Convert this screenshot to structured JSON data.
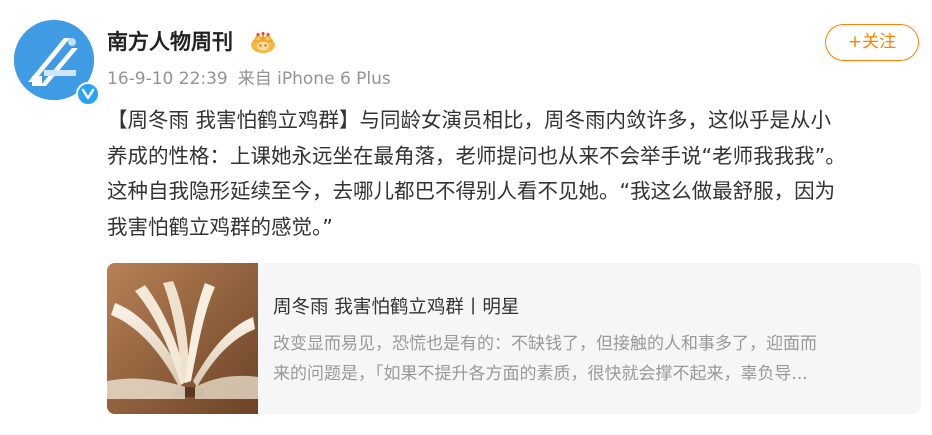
{
  "user": {
    "name": "南方人物周刊",
    "avatar": "southern-people-weekly-logo",
    "verified": true
  },
  "meta": {
    "date": "16-9-10 22:39",
    "source": "来自 iPhone 6 Plus"
  },
  "follow_button": {
    "label": "+关注"
  },
  "post": {
    "lines": [
      "【周冬雨 我害怕鹤立鸡群】与同龄女演员相比，周冬雨内敛许多，这似乎是从小",
      "养成的性格：上课她永远坐在最角落，老师提问也从来不会举手说“老师我我我”。",
      "这种自我隐形延续至今，去哪儿都巴不得别人看不见她。“我这么做最舒服，因为",
      "我害怕鹤立鸡群的感觉。”"
    ]
  },
  "link_card": {
    "thumbnail": "open-book-photo",
    "title": "周冬雨 我害怕鹤立鸡群丨明星",
    "summary_lines": [
      "改变显而易见，恐慌也是有的：不缺钱了，但接触的人和事多了，迎面而",
      "来的问题是，「如果不提升各方面的素质，很快就会撑不起来，辜负导..."
    ]
  },
  "colors": {
    "accent": "#ff8200",
    "avatar_bg": "#3f9be4",
    "verified": "#2aa3f5",
    "meta_text": "#939393",
    "card_bg": "#f6f6f6"
  }
}
